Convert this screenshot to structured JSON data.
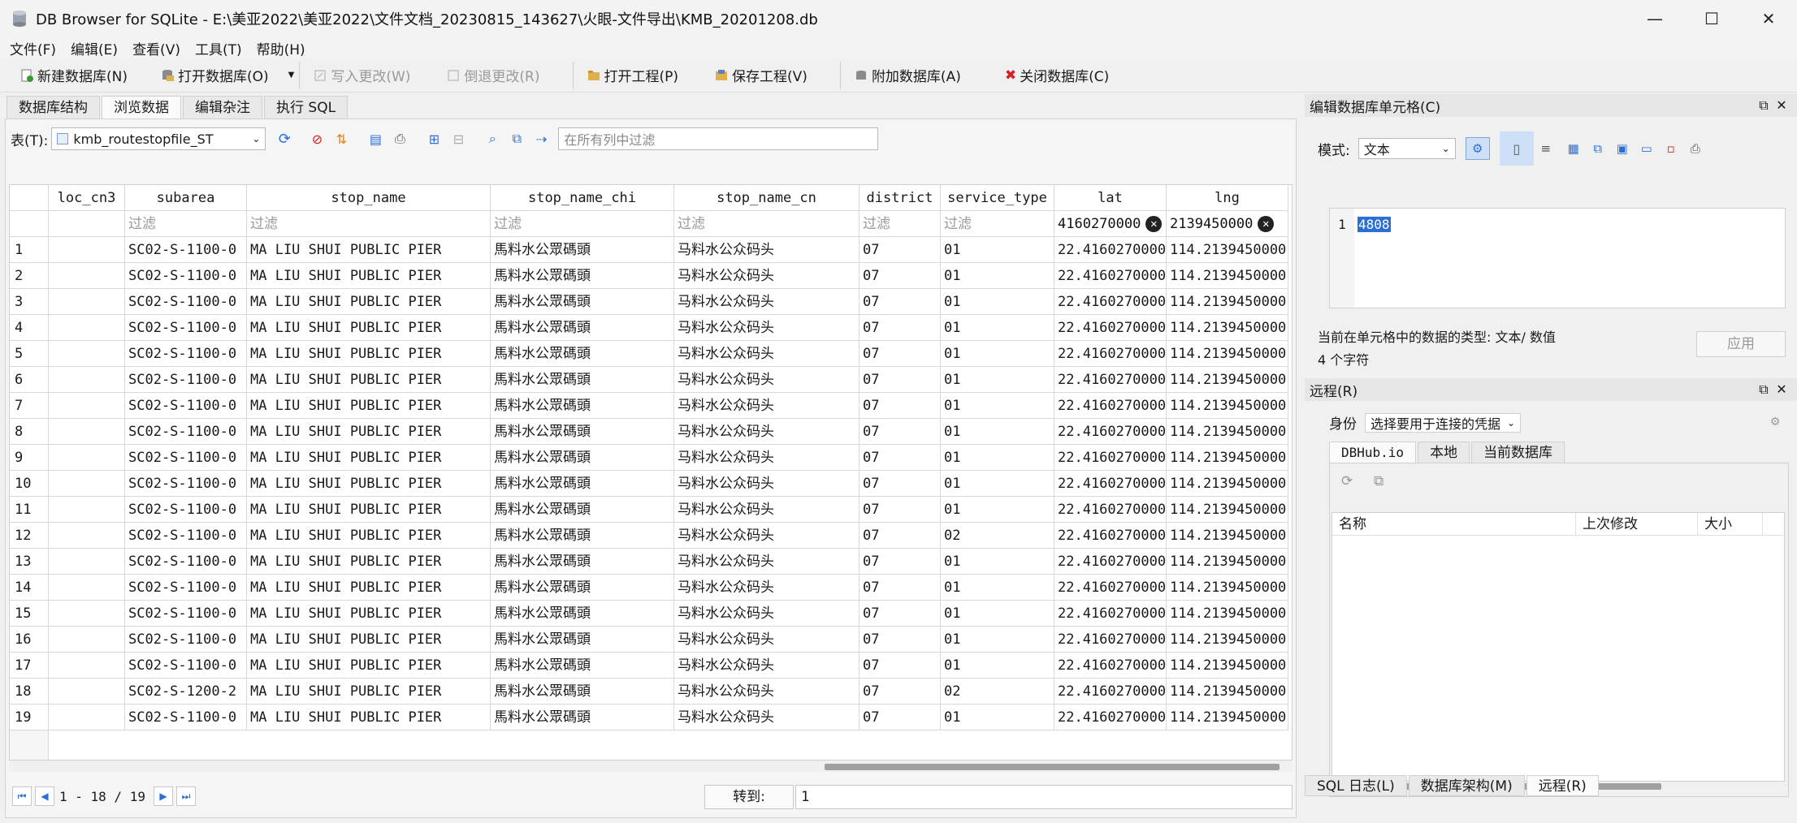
{
  "window": {
    "title": "DB Browser for SQLite - E:\\美亚2022\\美亚2022\\文件文档_20230815_143627\\火眼-文件导出\\KMB_20201208.db",
    "minimize": "—",
    "maximize": "☐",
    "close": "✕"
  },
  "menu": [
    "文件(F)",
    "编辑(E)",
    "查看(V)",
    "工具(T)",
    "帮助(H)"
  ],
  "toolbar": {
    "new_db": "新建数据库(N)",
    "open_db": "打开数据库(O)",
    "write_changes": "写入更改(W)",
    "revert_changes": "倒退更改(R)",
    "open_project": "打开工程(P)",
    "save_project": "保存工程(V)",
    "attach_db": "附加数据库(A)",
    "close_db": "关闭数据库(C)"
  },
  "tabs": [
    "数据库结构",
    "浏览数据",
    "编辑杂注",
    "执行 SQL"
  ],
  "browse": {
    "table_label": "表(T):",
    "table_name": "kmb_routestopfile_ST",
    "filter_all_placeholder": "在所有列中过滤",
    "columns": [
      "loc_cn3",
      "subarea",
      "stop_name",
      "stop_name_chi",
      "stop_name_cn",
      "district",
      "service_type",
      "lat",
      "lng"
    ],
    "filter_placeholder": "过滤",
    "lat_filter_value": "4160270000",
    "lng_filter_value": "2139450000",
    "rows": [
      {
        "n": "1",
        "subarea": "SC02-S-1100-0",
        "stop_name": "MA LIU SHUI PUBLIC PIER",
        "chi": "馬料水公眾碼頭",
        "cn": "马料水公众码头",
        "district": "07",
        "service": "01",
        "lat": "22.4160270000",
        "lng": "114.2139450000"
      },
      {
        "n": "2",
        "subarea": "SC02-S-1100-0",
        "stop_name": "MA LIU SHUI PUBLIC PIER",
        "chi": "馬料水公眾碼頭",
        "cn": "马料水公众码头",
        "district": "07",
        "service": "01",
        "lat": "22.4160270000",
        "lng": "114.2139450000"
      },
      {
        "n": "3",
        "subarea": "SC02-S-1100-0",
        "stop_name": "MA LIU SHUI PUBLIC PIER",
        "chi": "馬料水公眾碼頭",
        "cn": "马料水公众码头",
        "district": "07",
        "service": "01",
        "lat": "22.4160270000",
        "lng": "114.2139450000"
      },
      {
        "n": "4",
        "subarea": "SC02-S-1100-0",
        "stop_name": "MA LIU SHUI PUBLIC PIER",
        "chi": "馬料水公眾碼頭",
        "cn": "马料水公众码头",
        "district": "07",
        "service": "01",
        "lat": "22.4160270000",
        "lng": "114.2139450000"
      },
      {
        "n": "5",
        "subarea": "SC02-S-1100-0",
        "stop_name": "MA LIU SHUI PUBLIC PIER",
        "chi": "馬料水公眾碼頭",
        "cn": "马料水公众码头",
        "district": "07",
        "service": "01",
        "lat": "22.4160270000",
        "lng": "114.2139450000"
      },
      {
        "n": "6",
        "subarea": "SC02-S-1100-0",
        "stop_name": "MA LIU SHUI PUBLIC PIER",
        "chi": "馬料水公眾碼頭",
        "cn": "马料水公众码头",
        "district": "07",
        "service": "01",
        "lat": "22.4160270000",
        "lng": "114.2139450000"
      },
      {
        "n": "7",
        "subarea": "SC02-S-1100-0",
        "stop_name": "MA LIU SHUI PUBLIC PIER",
        "chi": "馬料水公眾碼頭",
        "cn": "马料水公众码头",
        "district": "07",
        "service": "01",
        "lat": "22.4160270000",
        "lng": "114.2139450000"
      },
      {
        "n": "8",
        "subarea": "SC02-S-1100-0",
        "stop_name": "MA LIU SHUI PUBLIC PIER",
        "chi": "馬料水公眾碼頭",
        "cn": "马料水公众码头",
        "district": "07",
        "service": "01",
        "lat": "22.4160270000",
        "lng": "114.2139450000"
      },
      {
        "n": "9",
        "subarea": "SC02-S-1100-0",
        "stop_name": "MA LIU SHUI PUBLIC PIER",
        "chi": "馬料水公眾碼頭",
        "cn": "马料水公众码头",
        "district": "07",
        "service": "01",
        "lat": "22.4160270000",
        "lng": "114.2139450000"
      },
      {
        "n": "10",
        "subarea": "SC02-S-1100-0",
        "stop_name": "MA LIU SHUI PUBLIC PIER",
        "chi": "馬料水公眾碼頭",
        "cn": "马料水公众码头",
        "district": "07",
        "service": "01",
        "lat": "22.4160270000",
        "lng": "114.2139450000"
      },
      {
        "n": "11",
        "subarea": "SC02-S-1100-0",
        "stop_name": "MA LIU SHUI PUBLIC PIER",
        "chi": "馬料水公眾碼頭",
        "cn": "马料水公众码头",
        "district": "07",
        "service": "01",
        "lat": "22.4160270000",
        "lng": "114.2139450000"
      },
      {
        "n": "12",
        "subarea": "SC02-S-1100-0",
        "stop_name": "MA LIU SHUI PUBLIC PIER",
        "chi": "馬料水公眾碼頭",
        "cn": "马料水公众码头",
        "district": "07",
        "service": "02",
        "lat": "22.4160270000",
        "lng": "114.2139450000"
      },
      {
        "n": "13",
        "subarea": "SC02-S-1100-0",
        "stop_name": "MA LIU SHUI PUBLIC PIER",
        "chi": "馬料水公眾碼頭",
        "cn": "马料水公众码头",
        "district": "07",
        "service": "01",
        "lat": "22.4160270000",
        "lng": "114.2139450000"
      },
      {
        "n": "14",
        "subarea": "SC02-S-1100-0",
        "stop_name": "MA LIU SHUI PUBLIC PIER",
        "chi": "馬料水公眾碼頭",
        "cn": "马料水公众码头",
        "district": "07",
        "service": "01",
        "lat": "22.4160270000",
        "lng": "114.2139450000"
      },
      {
        "n": "15",
        "subarea": "SC02-S-1100-0",
        "stop_name": "MA LIU SHUI PUBLIC PIER",
        "chi": "馬料水公眾碼頭",
        "cn": "马料水公众码头",
        "district": "07",
        "service": "01",
        "lat": "22.4160270000",
        "lng": "114.2139450000"
      },
      {
        "n": "16",
        "subarea": "SC02-S-1100-0",
        "stop_name": "MA LIU SHUI PUBLIC PIER",
        "chi": "馬料水公眾碼頭",
        "cn": "马料水公众码头",
        "district": "07",
        "service": "01",
        "lat": "22.4160270000",
        "lng": "114.2139450000"
      },
      {
        "n": "17",
        "subarea": "SC02-S-1100-0",
        "stop_name": "MA LIU SHUI PUBLIC PIER",
        "chi": "馬料水公眾碼頭",
        "cn": "马料水公众码头",
        "district": "07",
        "service": "01",
        "lat": "22.4160270000",
        "lng": "114.2139450000"
      },
      {
        "n": "18",
        "subarea": "SC02-S-1200-2",
        "stop_name": "MA LIU SHUI PUBLIC PIER",
        "chi": "馬料水公眾碼頭",
        "cn": "马料水公众码头",
        "district": "07",
        "service": "02",
        "lat": "22.4160270000",
        "lng": "114.2139450000"
      },
      {
        "n": "19",
        "subarea": "SC02-S-1100-0",
        "stop_name": "MA LIU SHUI PUBLIC PIER",
        "chi": "馬料水公眾碼頭",
        "cn": "马料水公众码头",
        "district": "07",
        "service": "01",
        "lat": "22.4160270000",
        "lng": "114.2139450000"
      }
    ],
    "pager_text": "1 - 18 / 19",
    "goto_label": "转到:",
    "goto_value": "1"
  },
  "edit_cell": {
    "title": "编辑数据库单元格(C)",
    "mode_label": "模式:",
    "mode_value": "文本",
    "line_no": "1",
    "value": "4808",
    "type_info": "当前在单元格中的数据的类型: 文本/ 数值",
    "char_count": "4 个字符",
    "apply": "应用"
  },
  "remote": {
    "title": "远程(R)",
    "identity_label": "身份",
    "identity_value": "选择要用于连接的凭据",
    "tabs": [
      "DBHub.io",
      "本地",
      "当前数据库"
    ],
    "columns": [
      "名称",
      "上次修改",
      "大小"
    ]
  },
  "bottom_tabs": [
    "SQL 日志(L)",
    "数据库架构(M)",
    "远程(R)"
  ],
  "colors": {
    "accent": "#2a6fd6",
    "close_red": "#d42020"
  }
}
